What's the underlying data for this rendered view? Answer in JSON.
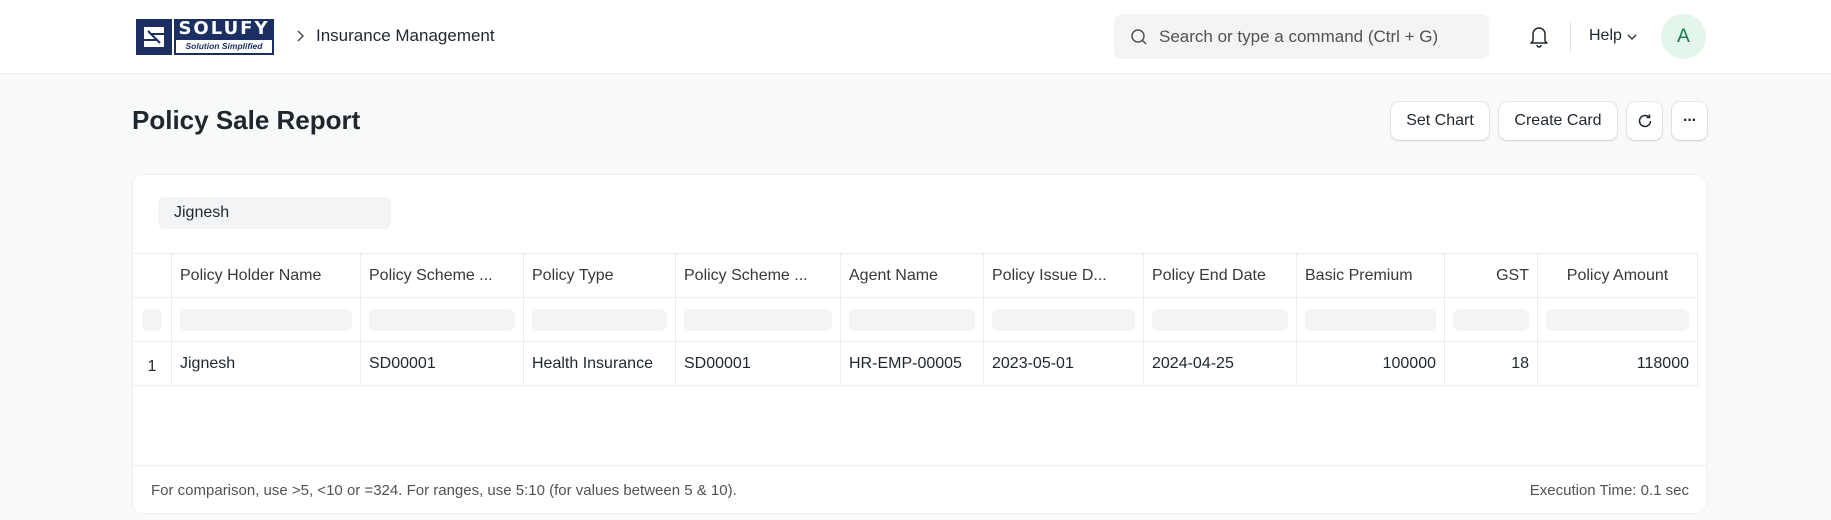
{
  "navbar": {
    "logo": {
      "brand": "SOLUFY",
      "tagline": "Solution Simplified"
    },
    "breadcrumb": "Insurance Management",
    "search_placeholder": "Search or type a command (Ctrl + G)",
    "help_label": "Help",
    "avatar_initial": "A"
  },
  "page": {
    "title": "Policy Sale Report",
    "actions": {
      "set_chart": "Set Chart",
      "create_card": "Create Card",
      "refresh_icon": "refresh-icon",
      "more_icon": "more-icon",
      "more_glyph": "···"
    }
  },
  "report": {
    "filter_value": "Jignesh",
    "columns": [
      {
        "label": "Policy Holder Name",
        "align": "left"
      },
      {
        "label": "Policy Scheme ...",
        "align": "left"
      },
      {
        "label": "Policy Type",
        "align": "left"
      },
      {
        "label": "Policy Scheme ...",
        "align": "left"
      },
      {
        "label": "Agent Name",
        "align": "left"
      },
      {
        "label": "Policy Issue D...",
        "align": "left"
      },
      {
        "label": "Policy End Date",
        "align": "left"
      },
      {
        "label": "Basic Premium",
        "align": "left"
      },
      {
        "label": "GST",
        "align": "right"
      },
      {
        "label": "Policy Amount",
        "align": "center"
      }
    ],
    "rows": [
      {
        "index": "1",
        "cells": [
          "Jignesh",
          "SD00001",
          "Health Insurance",
          "SD00001",
          "HR-EMP-00005",
          "2023-05-01",
          "2024-04-25",
          "100000",
          "18",
          "118000"
        ]
      }
    ],
    "footer_hint": "For comparison, use >5, <10 or =324. For ranges, use 5:10 (for values between 5 & 10).",
    "execution_time": "Execution Time: 0.1 sec"
  },
  "colors": {
    "brand_navy": "#1b2f63",
    "avatar_bg": "#e4f5e9",
    "avatar_fg": "#16794c"
  }
}
